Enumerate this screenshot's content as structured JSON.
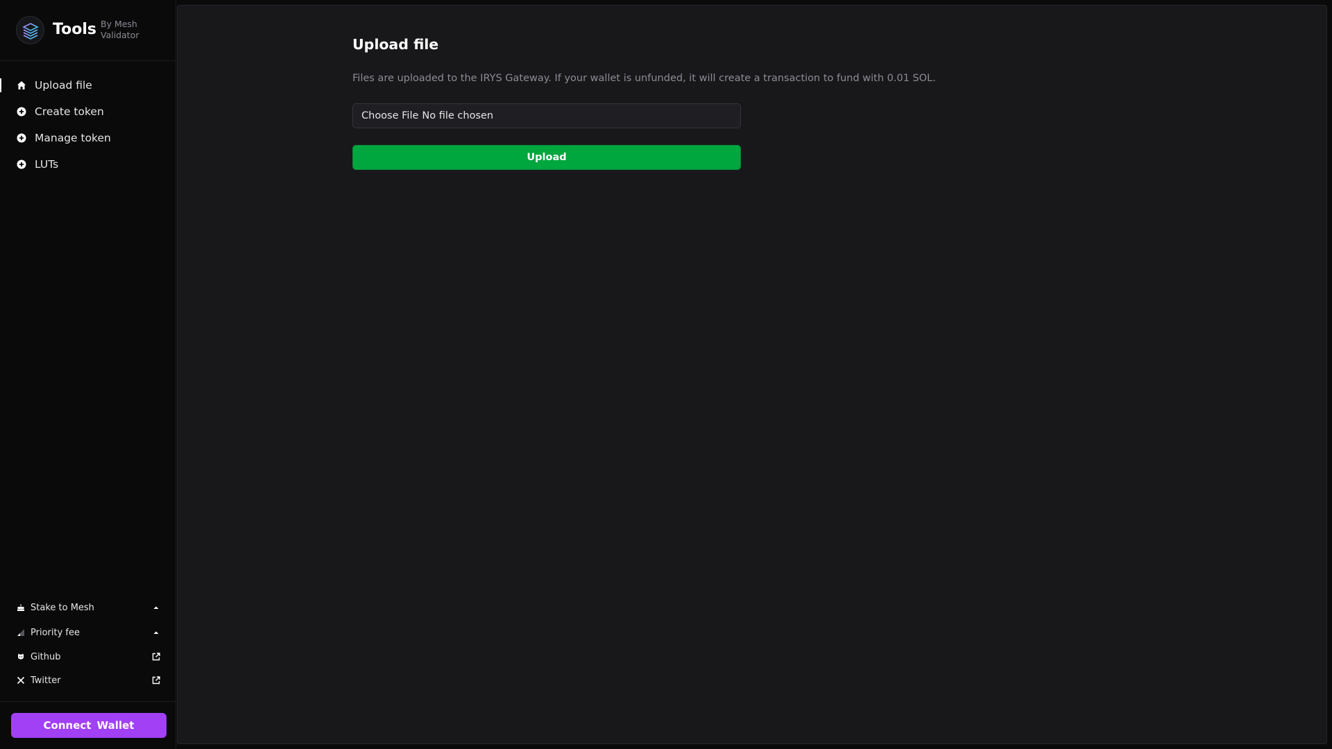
{
  "brand": {
    "title": "Tools",
    "subtitle": "By Mesh Validator",
    "logo_icon": "layers-stack-icon"
  },
  "sidebar": {
    "items": [
      {
        "label": "Upload file",
        "icon": "home-icon",
        "active": true
      },
      {
        "label": "Create token",
        "icon": "plus-circle-icon",
        "active": false
      },
      {
        "label": "Manage token",
        "icon": "plus-circle-icon",
        "active": false
      },
      {
        "label": "LUTs",
        "icon": "plus-circle-icon",
        "active": false
      }
    ],
    "footer": [
      {
        "label": "Stake to Mesh",
        "icon": "cake-icon",
        "trail": "chevron-up-icon"
      },
      {
        "label": "Priority fee",
        "icon": "signal-icon",
        "trail": "chevron-up-icon"
      },
      {
        "label": "Github",
        "icon": "github-icon",
        "trail": "external-link-icon"
      },
      {
        "label": "Twitter",
        "icon": "x-icon",
        "trail": "external-link-icon"
      }
    ],
    "wallet_button": "Connect Wallet"
  },
  "main": {
    "title": "Upload file",
    "description": "Files are uploaded to the IRYS Gateway. If your wallet is unfunded, it will create a transaction to fund with 0.01 SOL.",
    "file_input": {
      "button_label": "Choose File",
      "status": "No file chosen"
    },
    "upload_button": "Upload"
  },
  "colors": {
    "background": "#0a0a0b",
    "panel": "#18181b",
    "accent_green": "#00a63e",
    "accent_purple": "#a140f5",
    "muted_text": "#8b8d94"
  }
}
